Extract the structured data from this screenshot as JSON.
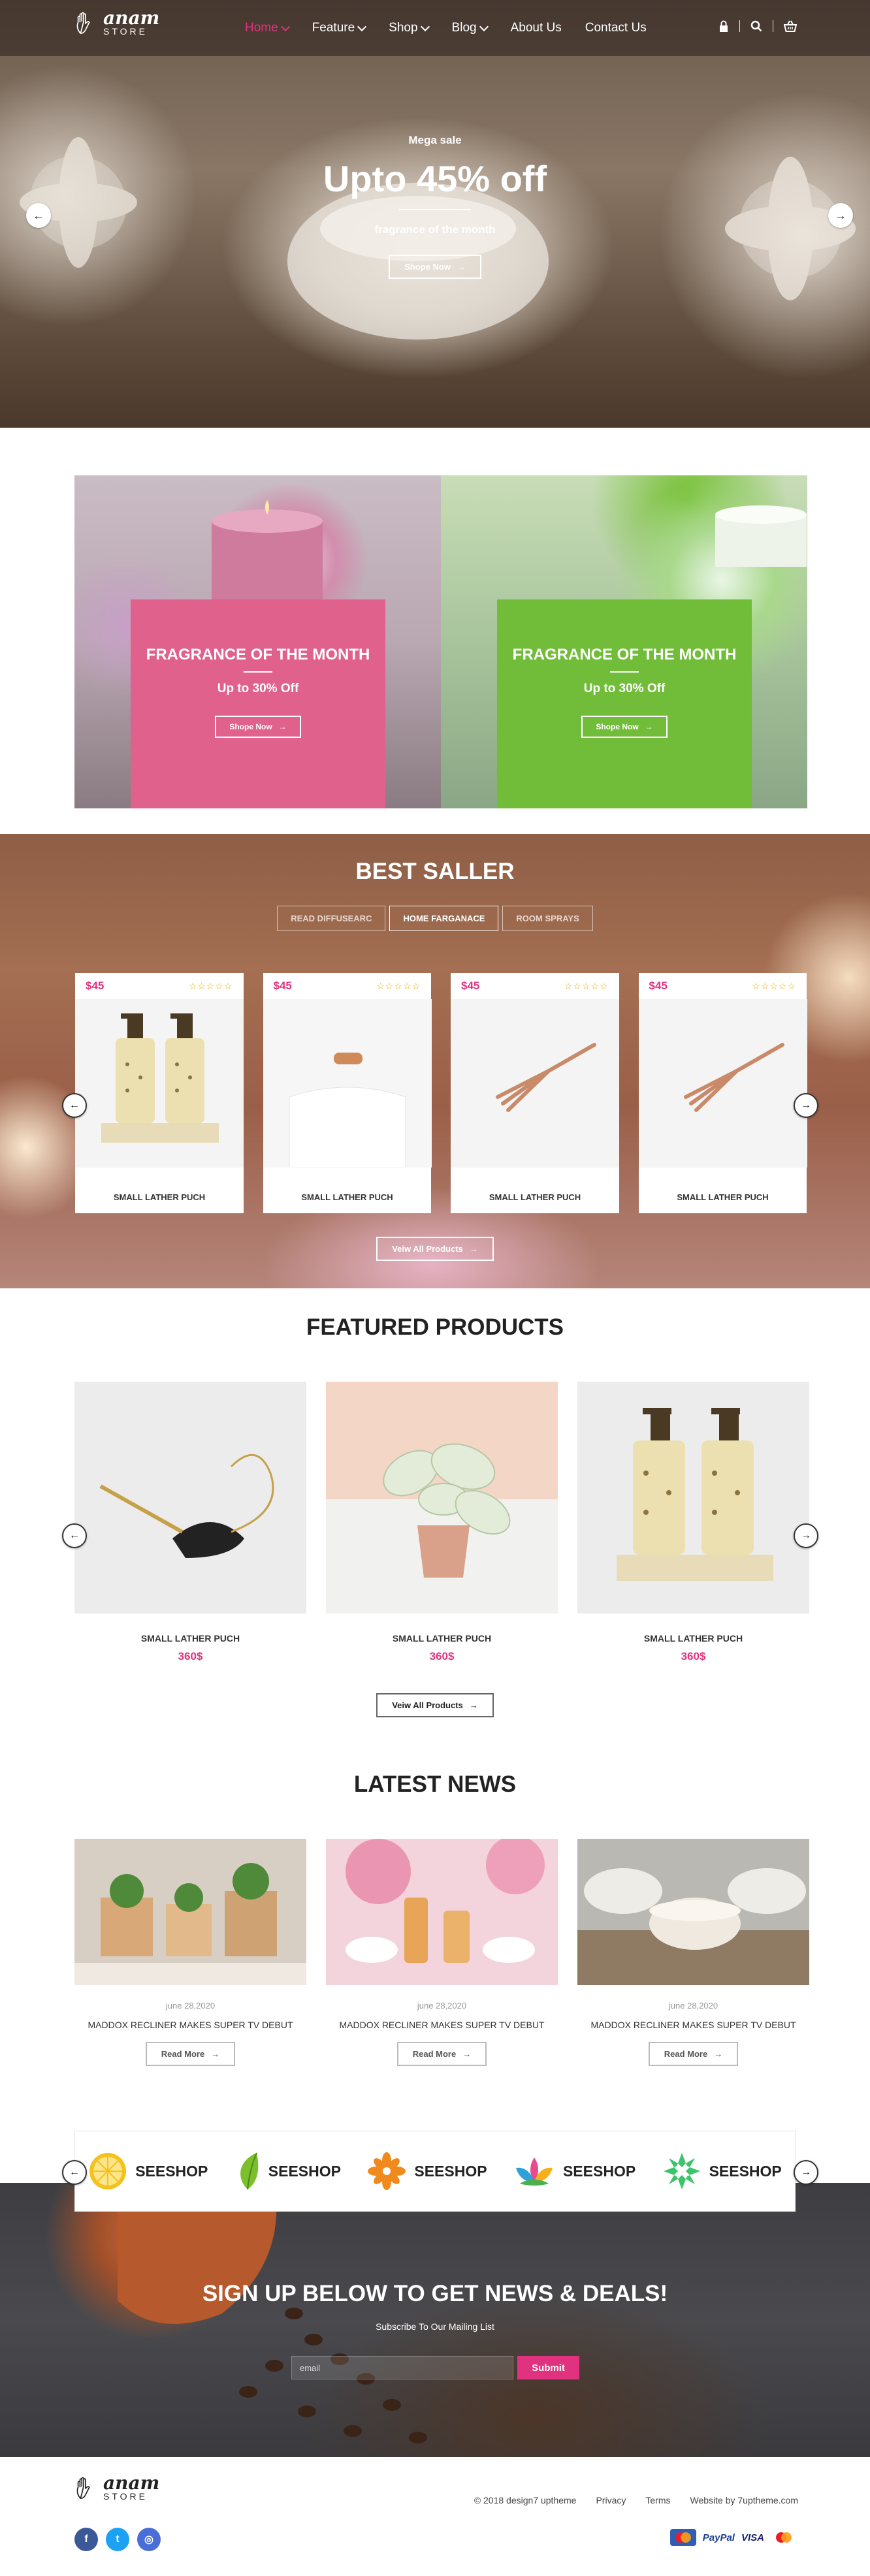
{
  "brand": {
    "name": "anam",
    "sub": "STORE"
  },
  "nav": {
    "items": [
      {
        "label": "Home",
        "dropdown": true,
        "active": true
      },
      {
        "label": "Feature",
        "dropdown": true
      },
      {
        "label": "Shop",
        "dropdown": true
      },
      {
        "label": "Blog",
        "dropdown": true
      },
      {
        "label": "About Us",
        "dropdown": false
      },
      {
        "label": "Contact Us",
        "dropdown": false
      }
    ],
    "icons": [
      "lock-icon",
      "search-icon",
      "basket-icon"
    ]
  },
  "hero": {
    "kicker": "Mega sale",
    "title": "Upto 45% off",
    "subtitle": "fragrance of the month",
    "button": "Shope Now"
  },
  "promos": [
    {
      "title": "FRAGRANCE OF THE MONTH",
      "offer": "Up to 30% Off",
      "button": "Shope Now",
      "color": "#e0618c"
    },
    {
      "title": "FRAGRANCE OF THE MONTH",
      "offer": "Up to 30% Off",
      "button": "Shope Now",
      "color": "#71bd3a"
    }
  ],
  "best_seller": {
    "title": "BEST SALLER",
    "tabs": [
      "READ DIFFUSEARC",
      "HOME FARGANACE",
      "ROOM SPRAYS"
    ],
    "products": [
      {
        "price": "$45",
        "name": "SMALL LATHER PUCH",
        "image": "soap-bottles"
      },
      {
        "price": "$45",
        "name": "SMALL LATHER PUCH",
        "image": "white-jar"
      },
      {
        "price": "$45",
        "name": "SMALL LATHER PUCH",
        "image": "copper-fork"
      },
      {
        "price": "$45",
        "name": "SMALL LATHER PUCH",
        "image": "copper-fork"
      }
    ],
    "button": "Veiw All Products"
  },
  "featured": {
    "title": "FEATURED PRODUCTS",
    "products": [
      {
        "name": "SMALL LATHER PUCH",
        "price": "360$",
        "image": "watering-can"
      },
      {
        "name": "SMALL LATHER PUCH",
        "price": "360$",
        "image": "plant-pot"
      },
      {
        "name": "SMALL LATHER PUCH",
        "price": "360$",
        "image": "soap-bottles"
      }
    ],
    "button": "Veiw All Products"
  },
  "news": {
    "title": "LATEST NEWS",
    "posts": [
      {
        "date": "june 28,2020",
        "title": "MADDOX RECLINER MAKES SUPER TV DEBUT",
        "button": "Read More",
        "image": "succulents"
      },
      {
        "date": "june 28,2020",
        "title": "MADDOX RECLINER MAKES SUPER TV DEBUT",
        "button": "Read More",
        "image": "oil-bottles"
      },
      {
        "date": "june 28,2020",
        "title": "MADDOX RECLINER MAKES SUPER TV DEBUT",
        "button": "Read More",
        "image": "white-candles"
      }
    ]
  },
  "brands": [
    {
      "name": "SEESHOP",
      "icon": "lemon-icon"
    },
    {
      "name": "SEESHOP",
      "icon": "leaf-icon"
    },
    {
      "name": "SEESHOP",
      "icon": "flower-icon"
    },
    {
      "name": "SEESHOP",
      "icon": "lotus-icon"
    },
    {
      "name": "SEESHOP",
      "icon": "green-flower-icon"
    }
  ],
  "signup": {
    "title": "SIGN UP BELOW TO GET NEWS & DEALS!",
    "subtitle": "Subscribe To Our Mailing List",
    "placeholder": "email",
    "button": "Submit"
  },
  "footer": {
    "copyright": "© 2018 design7 uptheme",
    "links": [
      "Privacy",
      "Terms"
    ],
    "credit": "Website by 7uptheme.com",
    "payments": [
      "mastercard-icon",
      "PayPal",
      "VISA",
      "mastercard-icon"
    ]
  },
  "colors": {
    "accent": "#e0327f",
    "pink": "#e0618c",
    "green": "#71bd3a"
  }
}
